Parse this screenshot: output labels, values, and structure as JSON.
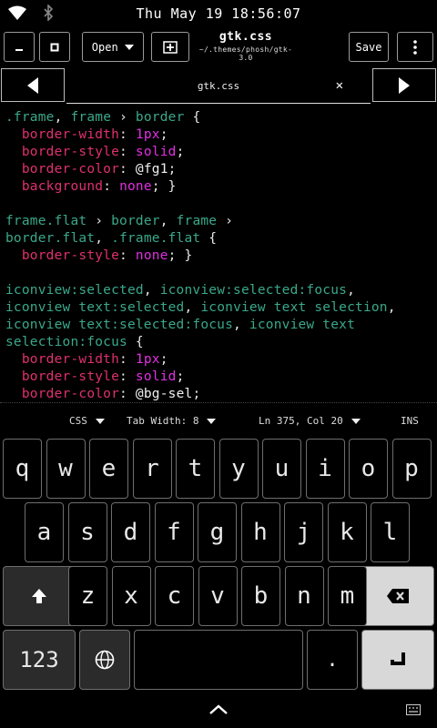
{
  "status_bar": {
    "clock": "Thu May 19 18:56:07"
  },
  "header": {
    "open_label": "Open",
    "title": "gtk.css",
    "subtitle": "~/.themes/phosh/gtk-3.0",
    "save_label": "Save"
  },
  "tab": {
    "label": "gtk.css",
    "close": "✕"
  },
  "code": [
    [
      [
        "sel",
        ".frame"
      ],
      [
        "pun",
        ", "
      ],
      [
        "sel",
        "frame"
      ],
      [
        "pun",
        " › "
      ],
      [
        "sel",
        "border"
      ],
      [
        "pun",
        " {"
      ]
    ],
    [
      [
        "pun",
        "  "
      ],
      [
        "prop",
        "border-width"
      ],
      [
        "pun",
        ": "
      ],
      [
        "val",
        "1px"
      ],
      [
        "pun",
        ";"
      ]
    ],
    [
      [
        "pun",
        "  "
      ],
      [
        "prop",
        "border-style"
      ],
      [
        "pun",
        ": "
      ],
      [
        "val",
        "solid"
      ],
      [
        "pun",
        ";"
      ]
    ],
    [
      [
        "pun",
        "  "
      ],
      [
        "prop",
        "border-color"
      ],
      [
        "pun",
        ": "
      ],
      [
        "var",
        "@fg1"
      ],
      [
        "pun",
        ";"
      ]
    ],
    [
      [
        "pun",
        "  "
      ],
      [
        "prop",
        "background"
      ],
      [
        "pun",
        ": "
      ],
      [
        "val",
        "none"
      ],
      [
        "pun",
        "; }"
      ]
    ],
    [],
    [
      [
        "sel",
        "frame.flat"
      ],
      [
        "pun",
        " › "
      ],
      [
        "sel",
        "border"
      ],
      [
        "pun",
        ", "
      ],
      [
        "sel",
        "frame"
      ],
      [
        "pun",
        " ›"
      ]
    ],
    [
      [
        "sel",
        "border.flat"
      ],
      [
        "pun",
        ", "
      ],
      [
        "sel",
        ".frame.flat"
      ],
      [
        "pun",
        " {"
      ]
    ],
    [
      [
        "pun",
        "  "
      ],
      [
        "prop",
        "border-style"
      ],
      [
        "pun",
        ": "
      ],
      [
        "val",
        "none"
      ],
      [
        "pun",
        "; }"
      ]
    ],
    [],
    [
      [
        "sel",
        "iconview:selected"
      ],
      [
        "pun",
        ", "
      ],
      [
        "sel",
        "iconview:selected:focus"
      ],
      [
        "pun",
        ","
      ]
    ],
    [
      [
        "sel",
        "iconview text:selected"
      ],
      [
        "pun",
        ", "
      ],
      [
        "sel",
        "iconview text selection"
      ],
      [
        "pun",
        ","
      ]
    ],
    [
      [
        "sel",
        "iconview text:selected:focus"
      ],
      [
        "pun",
        ", "
      ],
      [
        "sel",
        "iconview text"
      ]
    ],
    [
      [
        "sel",
        "selection:focus"
      ],
      [
        "pun",
        " {"
      ]
    ],
    [
      [
        "pun",
        "  "
      ],
      [
        "prop",
        "border-width"
      ],
      [
        "pun",
        ": "
      ],
      [
        "val",
        "1px"
      ],
      [
        "pun",
        ";"
      ]
    ],
    [
      [
        "pun",
        "  "
      ],
      [
        "prop",
        "border-style"
      ],
      [
        "pun",
        ": "
      ],
      [
        "val",
        "solid"
      ],
      [
        "pun",
        ";"
      ]
    ],
    [
      [
        "pun",
        "  "
      ],
      [
        "prop",
        "border-color"
      ],
      [
        "pun",
        ": "
      ],
      [
        "var",
        "@bg-sel"
      ],
      [
        "pun",
        ";"
      ]
    ]
  ],
  "status_row": {
    "language": "CSS",
    "tab_width": "Tab Width: 8",
    "position": "Ln 375, Col 20",
    "mode": "INS"
  },
  "keyboard": {
    "row1": [
      "q",
      "w",
      "e",
      "r",
      "t",
      "y",
      "u",
      "i",
      "o",
      "p"
    ],
    "row2": [
      "a",
      "s",
      "d",
      "f",
      "g",
      "h",
      "j",
      "k",
      "l"
    ],
    "row3": [
      "z",
      "x",
      "c",
      "v",
      "b",
      "n",
      "m"
    ],
    "numbers_label": "123",
    "period": "."
  },
  "colors": {
    "selector": "#3aa88a",
    "property": "#e0306f",
    "value": "#e030e0",
    "background": "#000000"
  }
}
